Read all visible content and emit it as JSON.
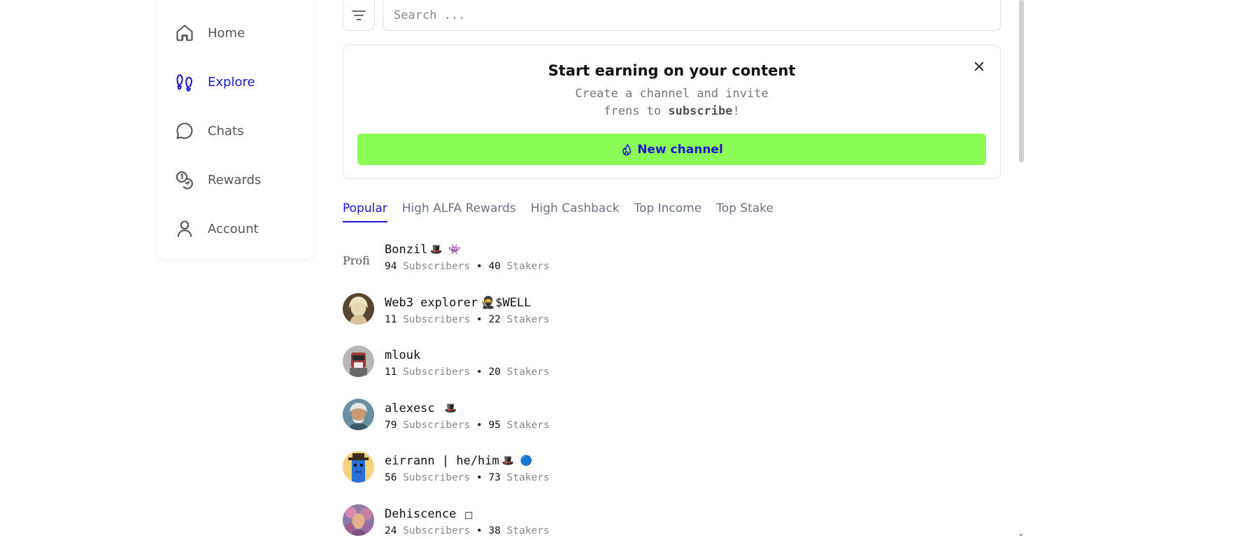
{
  "sidebar": {
    "items": [
      {
        "label": "Home",
        "icon": "home-icon",
        "active": false
      },
      {
        "label": "Explore",
        "icon": "footprints-icon",
        "active": true
      },
      {
        "label": "Chats",
        "icon": "chat-bubble-icon",
        "active": false
      },
      {
        "label": "Rewards",
        "icon": "coins-icon",
        "active": false
      },
      {
        "label": "Account",
        "icon": "user-icon",
        "active": false
      }
    ]
  },
  "search": {
    "placeholder": "Search ...",
    "value": ""
  },
  "promo": {
    "title": "Start earning on your content",
    "subtitle_line1": "Create a channel and invite",
    "subtitle_line2_prefix": "frens to ",
    "subtitle_line2_bold": "subscribe",
    "subtitle_line2_suffix": "!",
    "button_label": "New channel",
    "button_color": "#8afc55",
    "accent_color": "#1a1acc"
  },
  "tabs": [
    {
      "label": "Popular",
      "active": true
    },
    {
      "label": "High ALFA Rewards",
      "active": false
    },
    {
      "label": "High Cashback",
      "active": false
    },
    {
      "label": "Top Income",
      "active": false
    },
    {
      "label": "Top Stake",
      "active": false
    }
  ],
  "channels": [
    {
      "name": "Bonzil",
      "emoji": "🎩 👾",
      "subscribers": "94",
      "stakers": "40",
      "avatar_alt": "Profi"
    },
    {
      "name": "Web3 explorer",
      "emoji": "🥷$WELL",
      "subscribers": "11",
      "stakers": "22"
    },
    {
      "name": "mlouk",
      "emoji": "",
      "subscribers": "11",
      "stakers": "20"
    },
    {
      "name": "alexesc",
      "emoji": "🎩",
      "subscribers": "79",
      "stakers": "95"
    },
    {
      "name": "eirrann | he/him",
      "emoji": "🎩 🔵",
      "subscribers": "56",
      "stakers": "73"
    },
    {
      "name": "Dehiscence",
      "emoji": "☐",
      "subscribers": "24",
      "stakers": "38"
    }
  ],
  "labels": {
    "subscribers": "Subscribers",
    "stakers": "Stakers",
    "separator": "•"
  }
}
